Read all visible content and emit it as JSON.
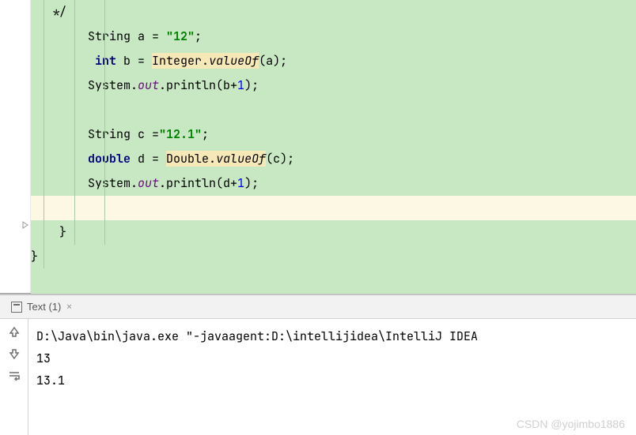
{
  "editor": {
    "lines": [
      {
        "bg": "green",
        "segs": [
          {
            "t": "   */",
            "cls": "plain"
          }
        ]
      },
      {
        "bg": "green",
        "segs": [
          {
            "t": "        String a = ",
            "cls": "plain"
          },
          {
            "t": "\"12\"",
            "cls": "str"
          },
          {
            "t": ";",
            "cls": "plain"
          }
        ]
      },
      {
        "bg": "green",
        "segs": [
          {
            "t": "         ",
            "cls": "plain"
          },
          {
            "t": "int",
            "cls": "kw"
          },
          {
            "t": " b = ",
            "cls": "plain"
          },
          {
            "t": "Integer.",
            "cls": "hl plain"
          },
          {
            "t": "valueOf",
            "cls": "hl method"
          },
          {
            "t": "(",
            "cls": "plain"
          },
          {
            "t": "a",
            "cls": "plain"
          },
          {
            "t": ");",
            "cls": "plain"
          }
        ]
      },
      {
        "bg": "green",
        "segs": [
          {
            "t": "        System.",
            "cls": "plain"
          },
          {
            "t": "out",
            "cls": "field"
          },
          {
            "t": ".println(b+",
            "cls": "plain"
          },
          {
            "t": "1",
            "cls": "num"
          },
          {
            "t": ");",
            "cls": "plain"
          }
        ]
      },
      {
        "bg": "green",
        "segs": [
          {
            "t": " ",
            "cls": "plain"
          }
        ]
      },
      {
        "bg": "green",
        "segs": [
          {
            "t": "        String c =",
            "cls": "plain"
          },
          {
            "t": "\"12.1\"",
            "cls": "str"
          },
          {
            "t": ";",
            "cls": "plain"
          }
        ]
      },
      {
        "bg": "green",
        "segs": [
          {
            "t": "        ",
            "cls": "plain"
          },
          {
            "t": "double",
            "cls": "kw"
          },
          {
            "t": " d = ",
            "cls": "plain"
          },
          {
            "t": "Double.",
            "cls": "hl plain"
          },
          {
            "t": "valueOf",
            "cls": "hl method"
          },
          {
            "t": "(c);",
            "cls": "plain"
          }
        ]
      },
      {
        "bg": "green",
        "segs": [
          {
            "t": "        System.",
            "cls": "plain"
          },
          {
            "t": "out",
            "cls": "field"
          },
          {
            "t": ".println(d+",
            "cls": "plain"
          },
          {
            "t": "1",
            "cls": "num"
          },
          {
            "t": ");",
            "cls": "plain"
          }
        ]
      },
      {
        "bg": "yellow",
        "segs": [
          {
            "t": " ",
            "cls": "plain"
          }
        ]
      },
      {
        "bg": "green",
        "segs": [
          {
            "t": "    }",
            "cls": "plain"
          }
        ]
      },
      {
        "bg": "green",
        "segs": [
          {
            "t": "}",
            "cls": "plain"
          }
        ]
      },
      {
        "bg": "green",
        "segs": [
          {
            "t": " ",
            "cls": "plain"
          }
        ]
      }
    ]
  },
  "tab": {
    "label": "Text (1)",
    "close": "×"
  },
  "console": {
    "cmd": "D:\\Java\\bin\\java.exe \"-javaagent:D:\\intellijidea\\IntelliJ IDEA ",
    "out1": "13",
    "out2": "13.1"
  },
  "watermark": "CSDN @yojimbo1886"
}
